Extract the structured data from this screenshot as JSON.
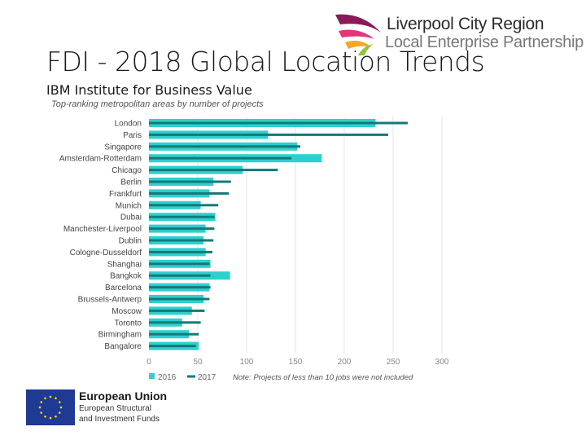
{
  "slide": {
    "title": "FDI - 2018 Global Location Trends",
    "subtitle": "IBM Institute for Business Value"
  },
  "logo": {
    "line1": "Liverpool City Region",
    "line2": "Local Enterprise Partnership",
    "colors": [
      "#8b1a5a",
      "#e8327a",
      "#f5a623",
      "#8dc63f"
    ]
  },
  "footer": {
    "eu_title": "European Union",
    "eu_line2": "European Structural",
    "eu_line3": "and Investment Funds",
    "eu_flag_color": "#1f3a93",
    "eu_star_color": "#ffdd00"
  },
  "chart_data": {
    "type": "bar",
    "orientation": "horizontal",
    "title": "Top-ranking metropolitan areas by number of projects",
    "xlabel": "",
    "ylabel": "",
    "xlim": [
      0,
      300
    ],
    "xticks": [
      0,
      50,
      100,
      150,
      200,
      250,
      300
    ],
    "grid": true,
    "legend_position": "bottom-left",
    "note": "Note: Projects of less than 10 jobs were not included",
    "categories": [
      "London",
      "Paris",
      "Singapore",
      "Amsterdam-Rotterdam",
      "Chicago",
      "Berlin",
      "Frankfurt",
      "Munich",
      "Dubai",
      "Manchester-Liverpool",
      "Dublin",
      "Cologne-Dusseldorf",
      "Shanghai",
      "Bangkok",
      "Barcelona",
      "Brussels-Antwerp",
      "Moscow",
      "Toronto",
      "Birmingham",
      "Bangalore"
    ],
    "series": [
      {
        "name": "2016",
        "color": "#2ecfcf",
        "values": [
          232,
          122,
          152,
          177,
          96,
          66,
          62,
          53,
          68,
          58,
          56,
          58,
          63,
          83,
          62,
          56,
          44,
          34,
          41,
          51
        ]
      },
      {
        "name": "2017",
        "color": "#137a78",
        "values": [
          265,
          245,
          155,
          146,
          132,
          84,
          82,
          71,
          67,
          67,
          66,
          65,
          62,
          63,
          63,
          62,
          57,
          53,
          51,
          48
        ]
      }
    ]
  }
}
